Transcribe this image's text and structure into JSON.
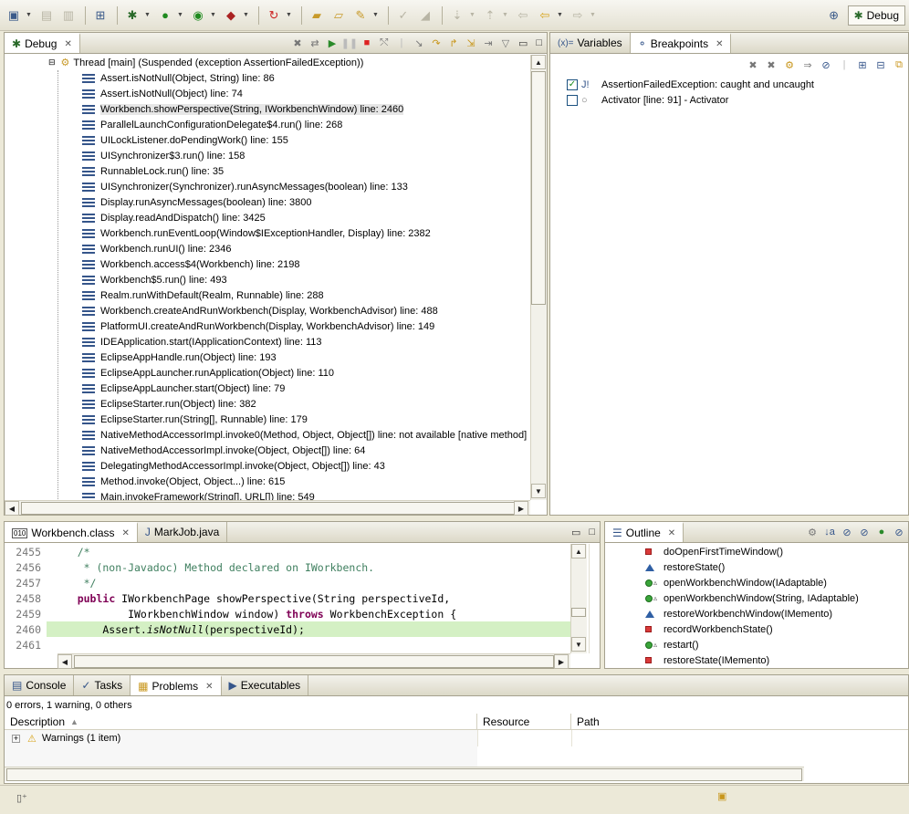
{
  "toolbar": {
    "perspective_label": "Debug"
  },
  "debug_view": {
    "tab_label": "Debug",
    "thread_label": "Thread [main] (Suspended (exception AssertionFailedException))",
    "frames": [
      "Assert.isNotNull(Object, String) line: 86",
      "Assert.isNotNull(Object) line: 74",
      "Workbench.showPerspective(String, IWorkbenchWindow) line: 2460",
      "ParallelLaunchConfigurationDelegate$4.run() line: 268",
      "UILockListener.doPendingWork() line: 155",
      "UISynchronizer$3.run() line: 158",
      "RunnableLock.run() line: 35",
      "UISynchronizer(Synchronizer).runAsyncMessages(boolean) line: 133",
      "Display.runAsyncMessages(boolean) line: 3800",
      "Display.readAndDispatch() line: 3425",
      "Workbench.runEventLoop(Window$IExceptionHandler, Display) line: 2382",
      "Workbench.runUI() line: 2346",
      "Workbench.access$4(Workbench) line: 2198",
      "Workbench$5.run() line: 493",
      "Realm.runWithDefault(Realm, Runnable) line: 288",
      "Workbench.createAndRunWorkbench(Display, WorkbenchAdvisor) line: 488",
      "PlatformUI.createAndRunWorkbench(Display, WorkbenchAdvisor) line: 149",
      "IDEApplication.start(IApplicationContext) line: 113",
      "EclipseAppHandle.run(Object) line: 193",
      "EclipseAppLauncher.runApplication(Object) line: 110",
      "EclipseAppLauncher.start(Object) line: 79",
      "EclipseStarter.run(Object) line: 382",
      "EclipseStarter.run(String[], Runnable) line: 179",
      "NativeMethodAccessorImpl.invoke0(Method, Object, Object[]) line: not available [native method]",
      "NativeMethodAccessorImpl.invoke(Object, Object[]) line: 64",
      "DelegatingMethodAccessorImpl.invoke(Object, Object[]) line: 43",
      "Method.invoke(Object, Object...) line: 615",
      "Main.invokeFramework(String[], URL[]) line: 549"
    ],
    "selected_index": 2
  },
  "variables_tab": {
    "label": "Variables"
  },
  "breakpoints_view": {
    "tab_label": "Breakpoints",
    "items": [
      {
        "label": "AssertionFailedException: caught and uncaught",
        "checked": true
      },
      {
        "label": "Activator [line: 91] - Activator",
        "checked": false
      }
    ]
  },
  "editor": {
    "tabs": [
      {
        "label": "Workbench.class"
      },
      {
        "label": "MarkJob.java"
      }
    ],
    "lines": [
      {
        "num": "2455",
        "segments": [
          {
            "t": "    /*",
            "c": "cm"
          }
        ]
      },
      {
        "num": "2456",
        "segments": [
          {
            "t": "     * (non-Javadoc) Method declared on IWorkbench.",
            "c": "cm"
          }
        ]
      },
      {
        "num": "2457",
        "segments": [
          {
            "t": "     */",
            "c": "cm"
          }
        ]
      },
      {
        "num": "2458",
        "segments": [
          {
            "t": "    ",
            "c": ""
          },
          {
            "t": "public",
            "c": "kw"
          },
          {
            "t": " IWorkbenchPage showPerspective(String perspectiveId,",
            "c": ""
          }
        ]
      },
      {
        "num": "2459",
        "segments": [
          {
            "t": "            IWorkbenchWindow window) ",
            "c": ""
          },
          {
            "t": "throws",
            "c": "kw"
          },
          {
            "t": " WorkbenchException {",
            "c": ""
          }
        ]
      },
      {
        "num": "2460",
        "segments": [
          {
            "t": "        Assert.",
            "c": ""
          },
          {
            "t": "isNotNull",
            "c": "it"
          },
          {
            "t": "(perspectiveId);",
            "c": ""
          }
        ]
      },
      {
        "num": "2461",
        "segments": [
          {
            "t": "",
            "c": ""
          }
        ]
      }
    ],
    "current_line_index": 5
  },
  "outline": {
    "tab_label": "Outline",
    "items": [
      {
        "label": "doOpenFirstTimeWindow()",
        "icon": "private-method-icon"
      },
      {
        "label": "restoreState()",
        "icon": "default-method-icon"
      },
      {
        "label": "openWorkbenchWindow(IAdaptable)",
        "icon": "public-method-icon"
      },
      {
        "label": "openWorkbenchWindow(String, IAdaptable)",
        "icon": "public-method-icon"
      },
      {
        "label": "restoreWorkbenchWindow(IMemento)",
        "icon": "default-method-icon"
      },
      {
        "label": "recordWorkbenchState()",
        "icon": "private-method-icon"
      },
      {
        "label": "restart()",
        "icon": "public-method-icon"
      },
      {
        "label": "restoreState(IMemento)",
        "icon": "private-method-icon"
      }
    ]
  },
  "bottom_panel": {
    "tabs": [
      {
        "label": "Console"
      },
      {
        "label": "Tasks"
      },
      {
        "label": "Problems"
      },
      {
        "label": "Executables"
      }
    ],
    "summary": "0 errors, 1 warning, 0 others",
    "columns": [
      "Description",
      "Resource",
      "Path"
    ],
    "rows": [
      {
        "description": "Warnings (1 item)",
        "resource": "",
        "path": ""
      }
    ]
  }
}
